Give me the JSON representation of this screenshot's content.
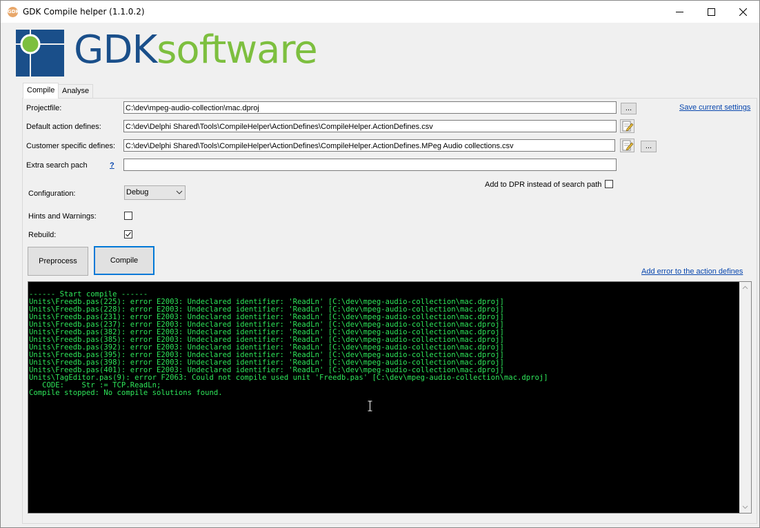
{
  "window": {
    "title": "GDK Compile helper (1.1.0.2)",
    "app_icon_label": "GDK"
  },
  "logo": {
    "text_gdk": "GDK",
    "text_software": "software"
  },
  "tabs": [
    {
      "label": "Compile",
      "active": true
    },
    {
      "label": "Analyse",
      "active": false
    }
  ],
  "form": {
    "projectfile_label": "Projectfile:",
    "projectfile_value": "C:\\dev\\mpeg-audio-collection\\mac.dproj",
    "default_defines_label": "Default action defines:",
    "default_defines_value": "C:\\dev\\Delphi Shared\\Tools\\CompileHelper\\ActionDefines\\CompileHelper.ActionDefines.csv",
    "customer_defines_label": "Customer specific defines:",
    "customer_defines_value": "C:\\dev\\Delphi Shared\\Tools\\CompileHelper\\ActionDefines\\CompileHelper.ActionDefines.MPeg Audio collections.csv",
    "extra_search_label": "Extra search pach",
    "extra_search_help": "?",
    "extra_search_value": "",
    "browse_label": "...",
    "save_settings_link": "Save current settings",
    "add_to_dpr_label": "Add to DPR instead of search path",
    "add_to_dpr_checked": false,
    "configuration_label": "Configuration:",
    "configuration_value": "Debug",
    "hints_label": "Hints and Warnings:",
    "hints_checked": false,
    "rebuild_label": "Rebuild:",
    "rebuild_checked": true,
    "preprocess_button": "Preprocess",
    "compile_button": "Compile",
    "add_error_link": "Add error to the action defines"
  },
  "console": {
    "text_color": "#2ee65a",
    "lines": [
      "------ Start compile ------",
      "Units\\Freedb.pas(225): error E2003: Undeclared identifier: 'ReadLn' [C:\\dev\\mpeg-audio-collection\\mac.dproj]",
      "Units\\Freedb.pas(228): error E2003: Undeclared identifier: 'ReadLn' [C:\\dev\\mpeg-audio-collection\\mac.dproj]",
      "Units\\Freedb.pas(231): error E2003: Undeclared identifier: 'ReadLn' [C:\\dev\\mpeg-audio-collection\\mac.dproj]",
      "Units\\Freedb.pas(237): error E2003: Undeclared identifier: 'ReadLn' [C:\\dev\\mpeg-audio-collection\\mac.dproj]",
      "Units\\Freedb.pas(382): error E2003: Undeclared identifier: 'ReadLn' [C:\\dev\\mpeg-audio-collection\\mac.dproj]",
      "Units\\Freedb.pas(385): error E2003: Undeclared identifier: 'ReadLn' [C:\\dev\\mpeg-audio-collection\\mac.dproj]",
      "Units\\Freedb.pas(392): error E2003: Undeclared identifier: 'ReadLn' [C:\\dev\\mpeg-audio-collection\\mac.dproj]",
      "Units\\Freedb.pas(395): error E2003: Undeclared identifier: 'ReadLn' [C:\\dev\\mpeg-audio-collection\\mac.dproj]",
      "Units\\Freedb.pas(398): error E2003: Undeclared identifier: 'ReadLn' [C:\\dev\\mpeg-audio-collection\\mac.dproj]",
      "Units\\Freedb.pas(401): error E2003: Undeclared identifier: 'ReadLn' [C:\\dev\\mpeg-audio-collection\\mac.dproj]",
      "Units\\TagEditor.pas(9): error F2063: Could not compile used unit 'Freedb.pas' [C:\\dev\\mpeg-audio-collection\\mac.dproj]",
      "   CODE:    Str := TCP.ReadLn;",
      "Compile stopped: No compile solutions found."
    ]
  }
}
